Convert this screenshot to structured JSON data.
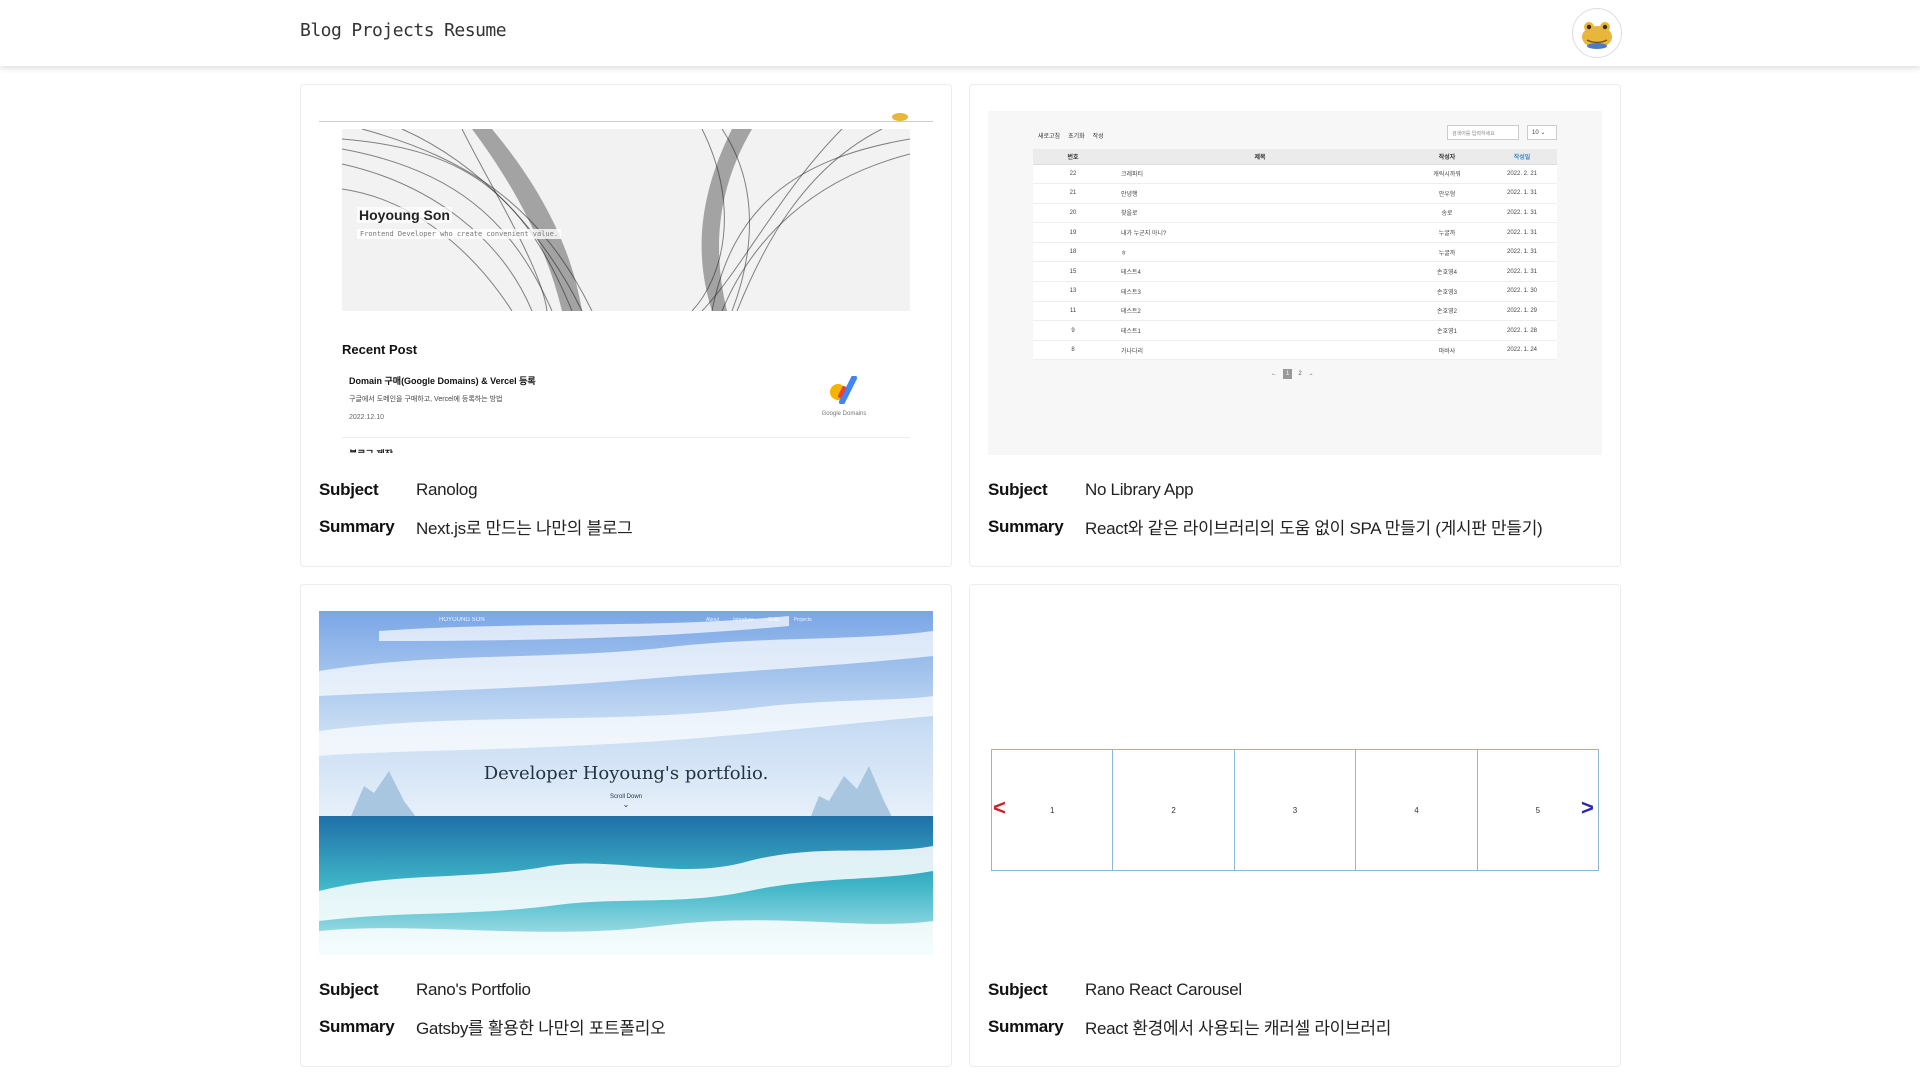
{
  "header": {
    "nav": [
      "Blog",
      "Projects",
      "Resume"
    ]
  },
  "projects": [
    {
      "subject_label": "Subject",
      "summary_label": "Summary",
      "subject": "Ranolog",
      "summary": "Next.js로 만드는 나만의 블로그",
      "preview": {
        "name": "Hoyoung Son",
        "tagline": "Frontend Developer who create convenient value.",
        "recent_heading": "Recent Post",
        "post_title": "Domain 구매(Google Domains) & Vercel 등록",
        "post_desc": "구글에서 도메인을 구매하고, Vercel에 등록하는 방법",
        "post_date": "2022.12.10",
        "post_thumb_label": "Google Domains",
        "next_post_title": "블로그 제작"
      }
    },
    {
      "subject_label": "Subject",
      "summary_label": "Summary",
      "subject": "No Library App",
      "summary": "React와 같은 라이브러리의 도움 없이 SPA 만들기 (게시판 만들기)",
      "preview": {
        "menu": [
          "새로고침",
          "초기화",
          "작성"
        ],
        "search_placeholder": "검색어를 입력하세요",
        "page_size": "10 ⌄",
        "columns": [
          "번호",
          "제목",
          "작성자",
          "작성일"
        ],
        "rows": [
          [
            "22",
            "크레파티",
            "캐릭시까워",
            "2022. 2. 21"
          ],
          [
            "21",
            "안녕행",
            "안우형",
            "2022. 1. 31"
          ],
          [
            "20",
            "찾을로",
            "송로",
            "2022. 1. 31"
          ],
          [
            "19",
            "내가 누군지 아니?",
            "누굴까",
            "2022. 1. 31"
          ],
          [
            "18",
            "ㅎ",
            "누굴까",
            "2022. 1. 31"
          ],
          [
            "15",
            "테스트4",
            "손호영4",
            "2022. 1. 31"
          ],
          [
            "13",
            "테스트3",
            "손호영3",
            "2022. 1. 30"
          ],
          [
            "11",
            "테스트2",
            "손호영2",
            "2022. 1. 29"
          ],
          [
            "9",
            "테스트1",
            "손호영1",
            "2022. 1. 28"
          ],
          [
            "8",
            "가나다리",
            "마바사",
            "2022. 1. 24"
          ]
        ],
        "pager": [
          "←",
          "1",
          "2",
          "→"
        ]
      }
    },
    {
      "subject_label": "Subject",
      "summary_label": "Summary",
      "subject": "Rano's Portfolio",
      "summary": "Gatsby를 활용한 나만의 포트폴리오",
      "preview": {
        "logo": "HOYOUNG SON",
        "nav": [
          "About",
          "Introduce",
          "Skills",
          "Projects"
        ],
        "title": "Developer Hoyoung's portfolio.",
        "scroll": "Scroll Down",
        "chevron": "⌄"
      }
    },
    {
      "subject_label": "Subject",
      "summary_label": "Summary",
      "subject": "Rano React Carousel",
      "summary": "React 환경에서 사용되는 캐러셀 라이브러리",
      "preview": {
        "slides": [
          "1",
          "2",
          "3",
          "4",
          "5"
        ],
        "prev": "<",
        "next": ">"
      }
    }
  ],
  "colors": {
    "card_border": "#ececec",
    "header_shadow": "rgba(0,0,0,0.14)",
    "carousel_prev": "#c8232c",
    "carousel_next": "#2a2aa8",
    "link_sort": "#3a8ad0"
  },
  "icons": {
    "avatar": "frog-avatar-icon",
    "google_domains": "google-domains-logo-icon"
  }
}
